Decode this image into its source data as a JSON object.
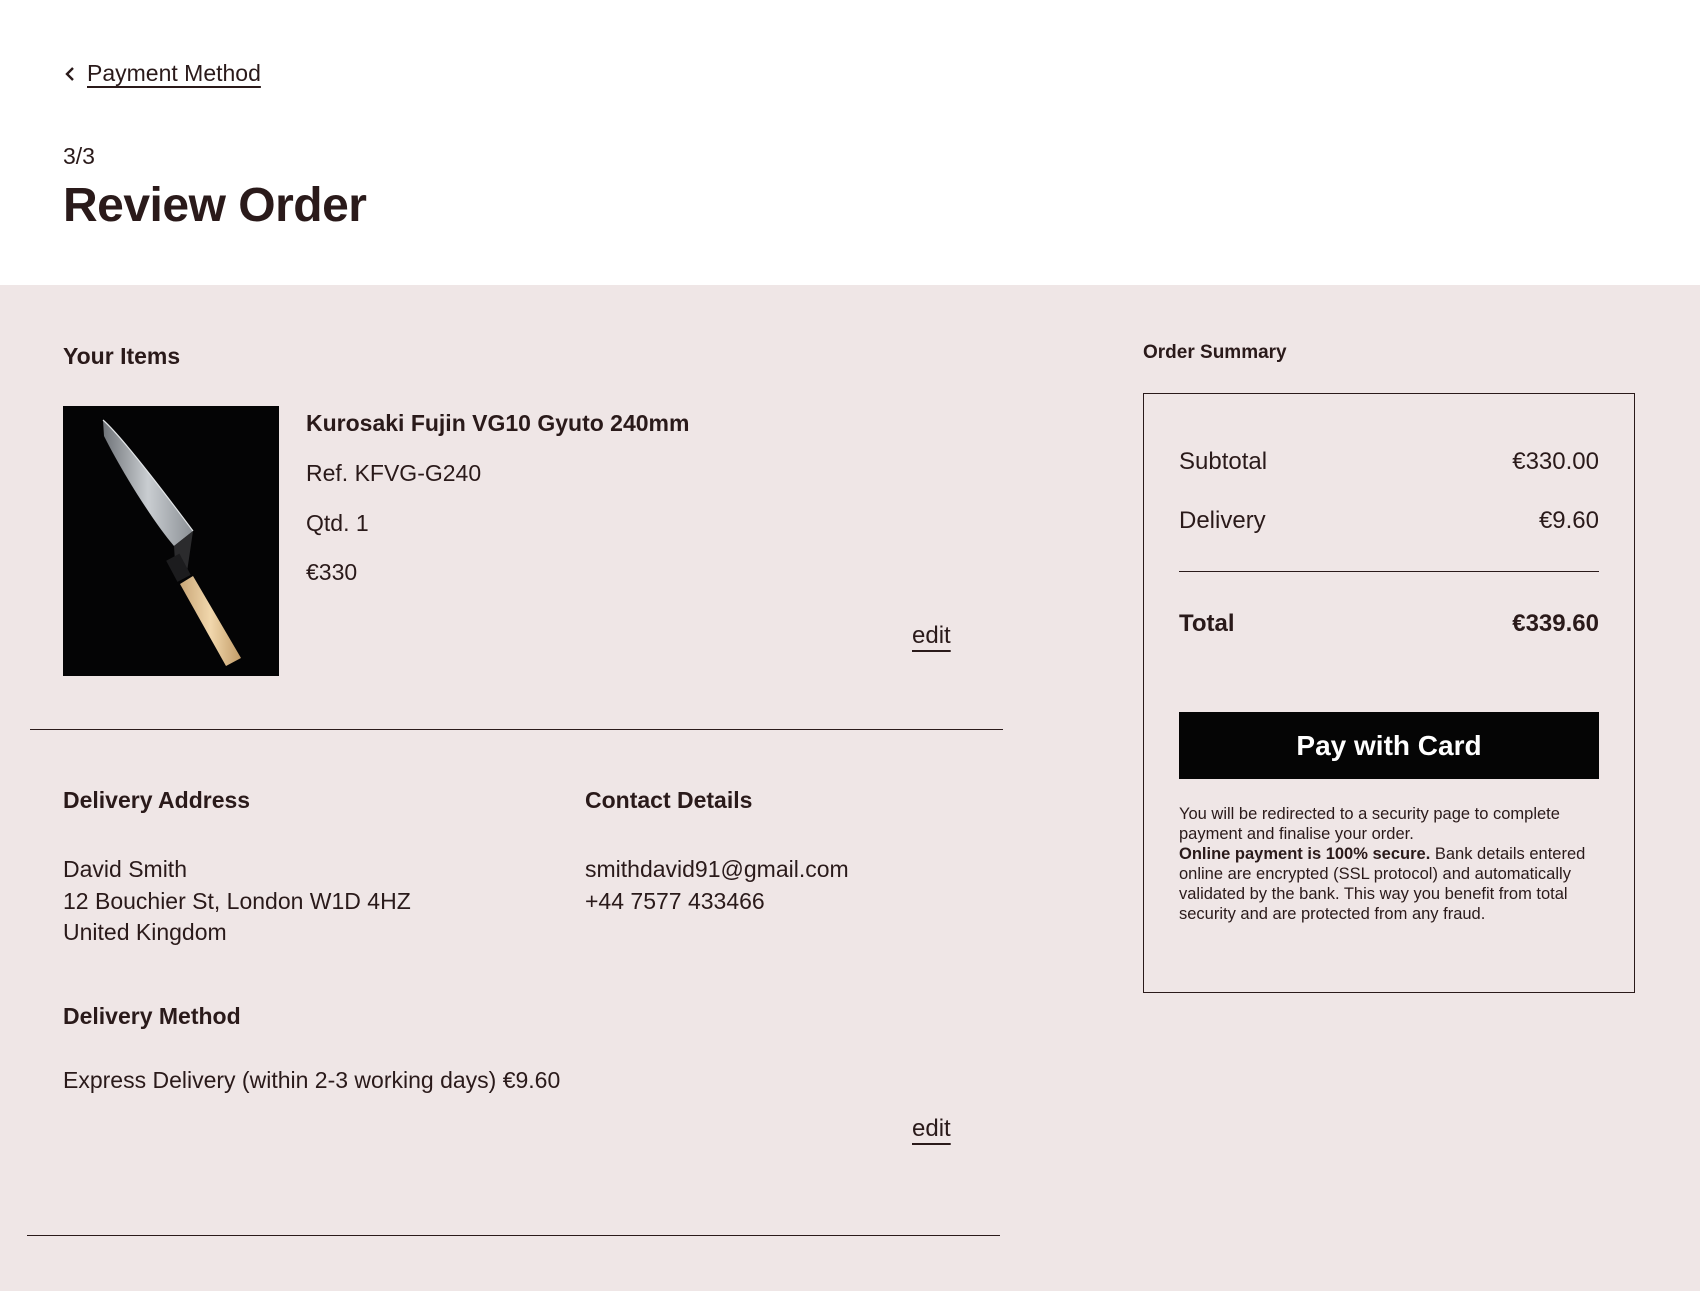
{
  "header": {
    "back_label": "Payment Method",
    "step": "3/3",
    "title": "Review Order"
  },
  "items": {
    "section_title": "Your Items",
    "product": {
      "name": "Kurosaki Fujin VG10 Gyuto 240mm",
      "ref": "Ref. KFVG-G240",
      "qty": "Qtd. 1",
      "price": "€330"
    },
    "edit_label": "edit"
  },
  "delivery_address": {
    "title": "Delivery Address",
    "name": "David Smith",
    "street": "12 Bouchier St, London W1D 4HZ",
    "country": "United Kingdom"
  },
  "contact_details": {
    "title": "Contact Details",
    "email": "smithdavid91@gmail.com",
    "phone": "+44 7577 433466"
  },
  "delivery_method": {
    "title": "Delivery Method",
    "value": "Express Delivery (within 2-3 working days) €9.60",
    "edit_label": "edit"
  },
  "summary": {
    "title": "Order Summary",
    "subtotal_label": "Subtotal",
    "subtotal_value": "€330.00",
    "delivery_label": "Delivery",
    "delivery_value": "€9.60",
    "total_label": "Total",
    "total_value": "€339.60",
    "pay_label": "Pay with Card",
    "note_intro": "You will be redirected to a security page to complete payment and finalise your order.",
    "note_bold": "Online payment is 100% secure.",
    "note_rest": " Bank details entered online are encrypted (SSL protocol) and automatically validated by the bank. This  way you benefit from total security and are protected from any fraud."
  },
  "colors": {
    "page_background": "#efe6e6",
    "header_background": "#ffffff",
    "text": "#2a1a1a",
    "button_background": "#050505",
    "button_text": "#ffffff"
  },
  "icons": {
    "back": "chevron-left-icon"
  }
}
